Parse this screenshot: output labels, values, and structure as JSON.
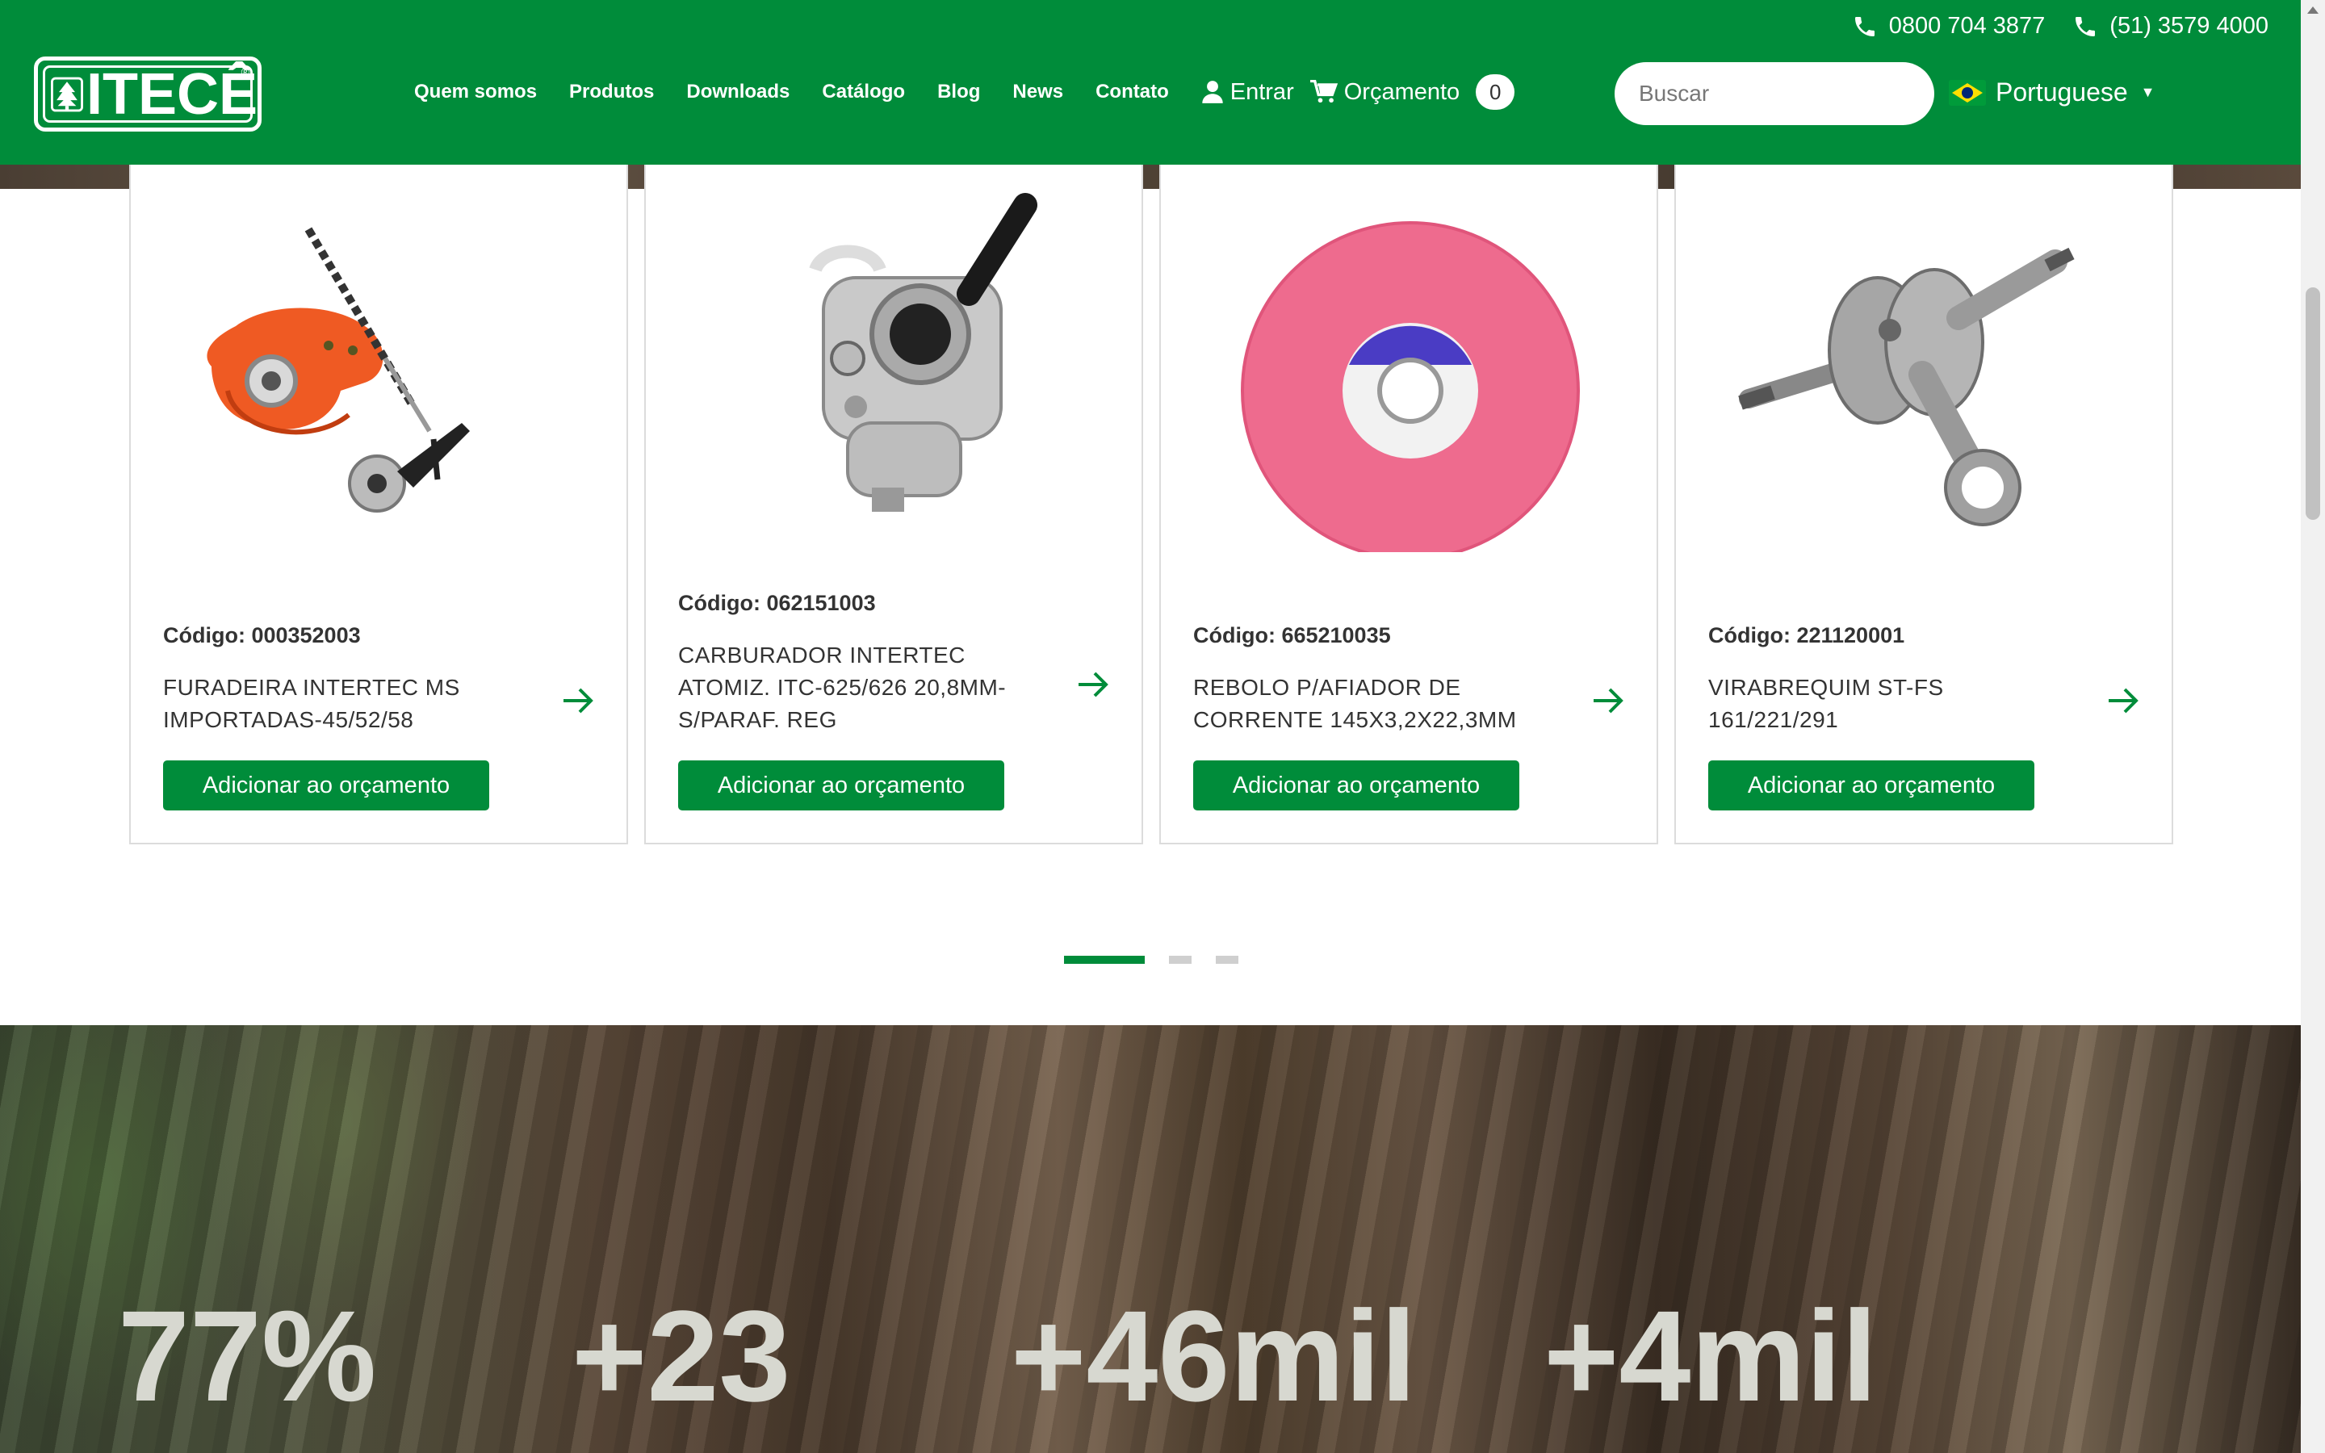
{
  "header": {
    "phones": [
      "0800 704 3877",
      "(51) 3579 4000"
    ],
    "logo_text": "ITECÊ",
    "nav": [
      "Quem somos",
      "Produtos",
      "Downloads",
      "Catálogo",
      "Blog",
      "News",
      "Contato"
    ],
    "login_label": "Entrar",
    "cart_label": "Orçamento",
    "cart_count": "0",
    "search_placeholder": "Buscar",
    "language": "Portuguese"
  },
  "products": [
    {
      "code": "Código: 000352003",
      "name": "FURADEIRA INTERTEC MS IMPORTADAS-45/52/58",
      "button": "Adicionar ao orçamento",
      "image": "drill-attachment-image"
    },
    {
      "code": "Código: 062151003",
      "name": "CARBURADOR INTERTEC ATOMIZ. ITC-625/626 20,8MM-S/PARAF. REG",
      "button": "Adicionar ao orçamento",
      "image": "carburetor-image"
    },
    {
      "code": "Código: 665210035",
      "name": "REBOLO P/AFIADOR DE CORRENTE 145X3,2X22,3MM",
      "button": "Adicionar ao orçamento",
      "image": "grinding-wheel-image"
    },
    {
      "code": "Código: 221120001",
      "name": "VIRABREQUIM ST-FS 161/221/291",
      "button": "Adicionar ao orçamento",
      "image": "crankshaft-image"
    }
  ],
  "carousel": {
    "pages": 3,
    "active": 1
  },
  "stats": [
    "77%",
    "+23",
    "+46mil",
    "+4mil"
  ],
  "colors": {
    "brand_green": "#008c3a",
    "stat_text": "#d7d8d0"
  }
}
